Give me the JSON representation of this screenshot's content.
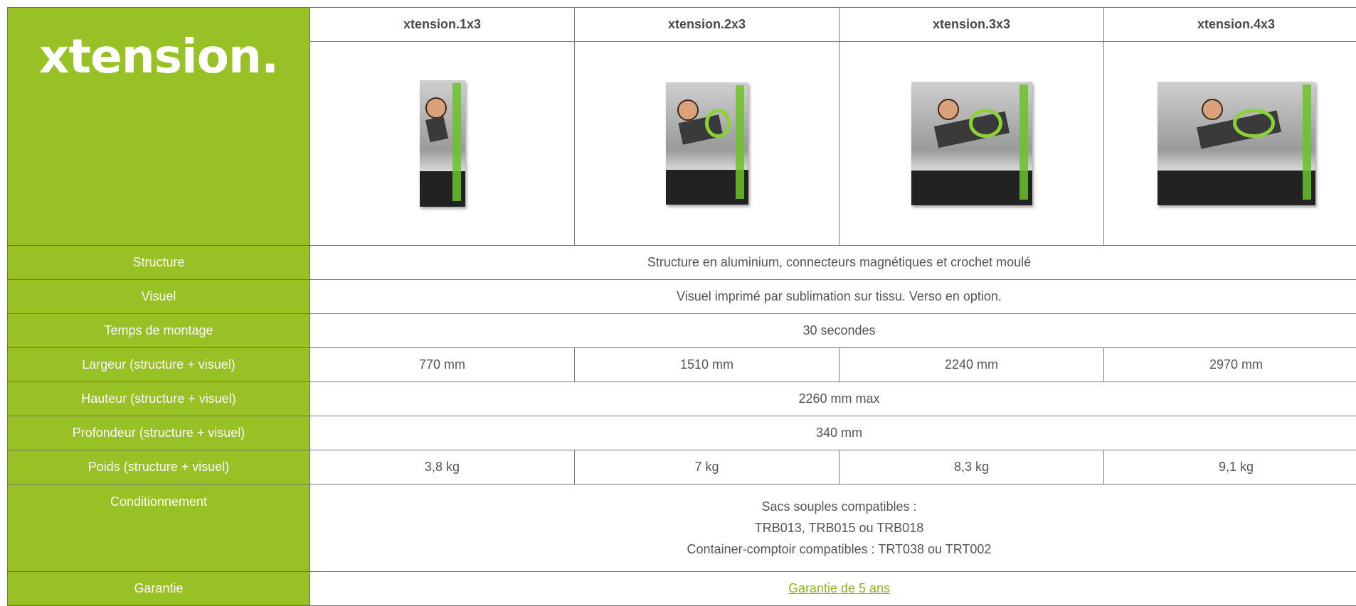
{
  "brand": {
    "logo_text": "xtension."
  },
  "products": [
    {
      "name": "xtension.1x3",
      "image": "xtension-1x3-visual"
    },
    {
      "name": "xtension.2x3",
      "image": "xtension-2x3-visual"
    },
    {
      "name": "xtension.3x3",
      "image": "xtension-3x3-visual"
    },
    {
      "name": "xtension.4x3",
      "image": "xtension-4x3-visual"
    }
  ],
  "rows": {
    "structure": {
      "label": "Structure",
      "value": "Structure en aluminium, connecteurs magnétiques et crochet moulé"
    },
    "visuel": {
      "label": "Visuel",
      "value": "Visuel imprimé par sublimation sur tissu. Verso en option."
    },
    "temps": {
      "label": "Temps de montage",
      "value": "30 secondes"
    },
    "largeur": {
      "label": "Largeur (structure + visuel)",
      "values": [
        "770 mm",
        "1510 mm",
        "2240 mm",
        "2970 mm"
      ]
    },
    "hauteur": {
      "label": "Hauteur (structure + visuel)",
      "value": "2260 mm max"
    },
    "profondeur": {
      "label": "Profondeur (structure + visuel)",
      "value": "340 mm"
    },
    "poids": {
      "label": "Poids (structure + visuel)",
      "values": [
        "3,8 kg",
        "7 kg",
        "8,3 kg",
        "9,1 kg"
      ]
    },
    "conditionnement": {
      "label": "Conditionnement",
      "lines": [
        "Sacs souples compatibles :",
        "TRB013, TRB015 ou TRB018",
        "Container-comptoir compatibles : TRT038 ou TRT002"
      ]
    },
    "garantie": {
      "label": "Garantie",
      "link_text": "Garantie de 5 ans"
    }
  },
  "colors": {
    "accent_green": "#97c125",
    "link_green": "#8fb71d",
    "border": "#7a7a7a"
  }
}
